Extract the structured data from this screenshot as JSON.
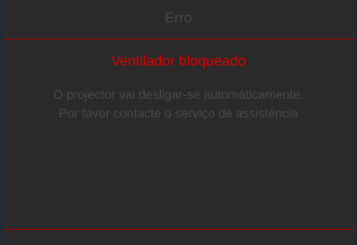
{
  "dialog": {
    "title": "Erro",
    "headline": "Ventilador bloqueado",
    "message_lines": [
      "O projector vai desligar-se automáticamente.",
      "Por favor contacte o serviço de assistência"
    ]
  },
  "colors": {
    "background": "#2a2a2a",
    "accent_red": "#e00000",
    "rule_red": "#b00000",
    "muted_text": "#4a4a4a"
  }
}
